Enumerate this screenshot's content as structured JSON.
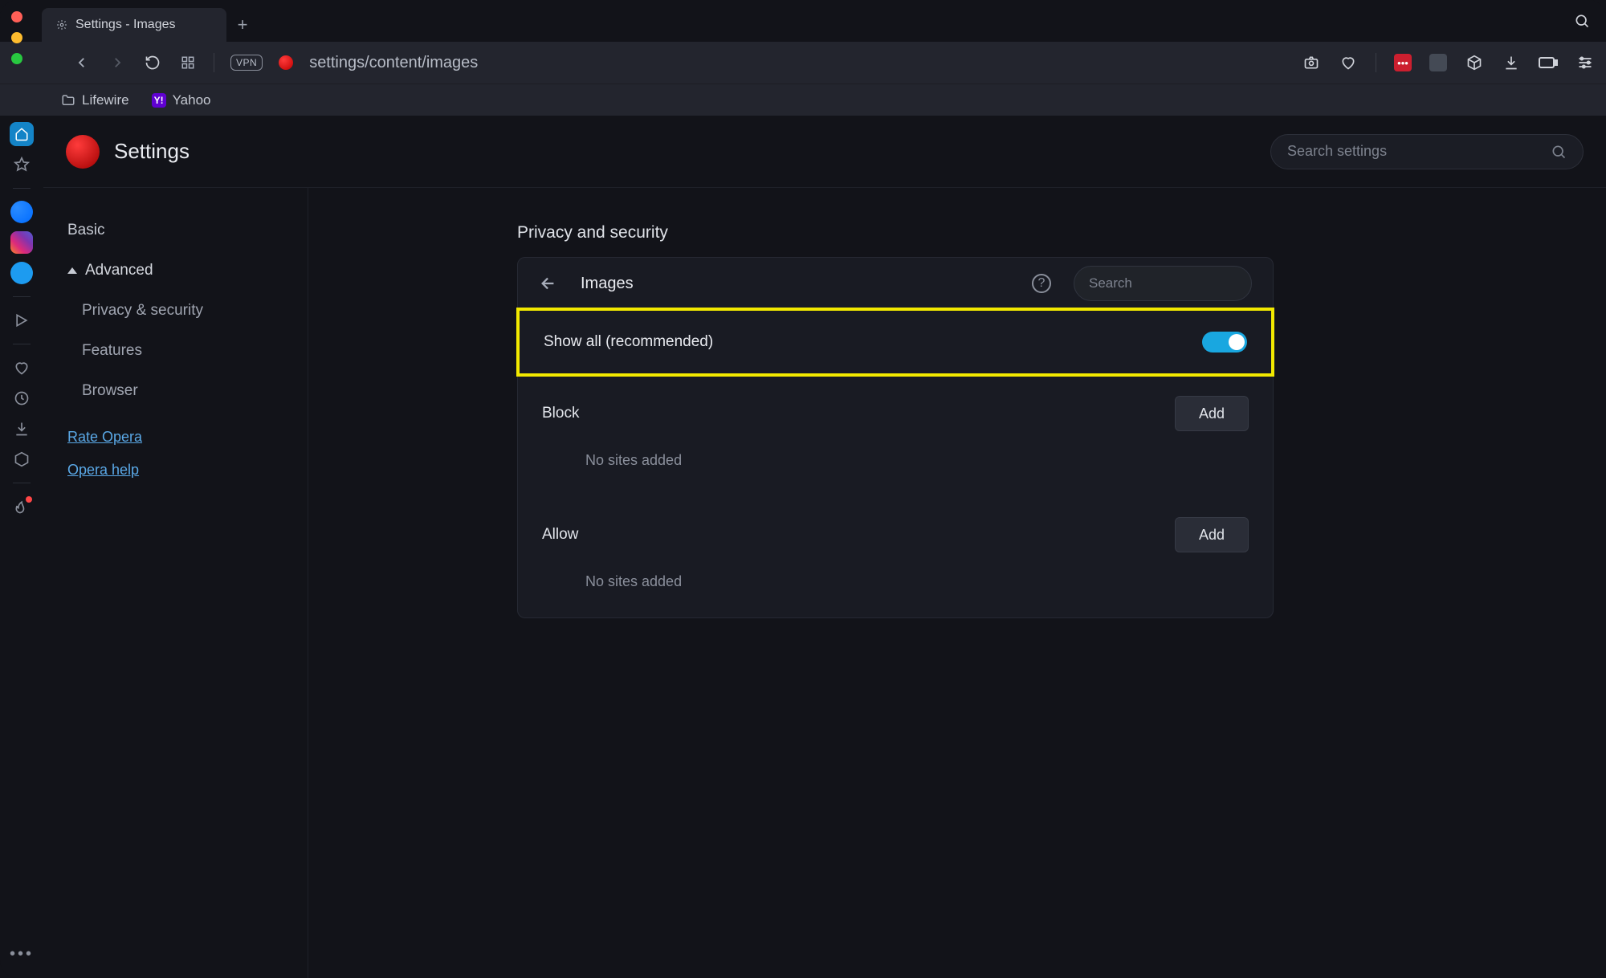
{
  "tab": {
    "title": "Settings - Images"
  },
  "url": "settings/content/images",
  "vpn": "VPN",
  "bookmarks": [
    {
      "label": "Lifewire"
    },
    {
      "label": "Yahoo"
    }
  ],
  "settings_header": {
    "title": "Settings",
    "search_placeholder": "Search settings"
  },
  "sidebar": {
    "basic": "Basic",
    "advanced": "Advanced",
    "privacy": "Privacy & security",
    "features": "Features",
    "browser": "Browser",
    "rate": "Rate Opera",
    "help": "Opera help"
  },
  "panel": {
    "section": "Privacy and security",
    "title": "Images",
    "search_placeholder": "Search",
    "show_all": "Show all (recommended)",
    "block": "Block",
    "allow": "Allow",
    "add": "Add",
    "no_sites": "No sites added"
  }
}
